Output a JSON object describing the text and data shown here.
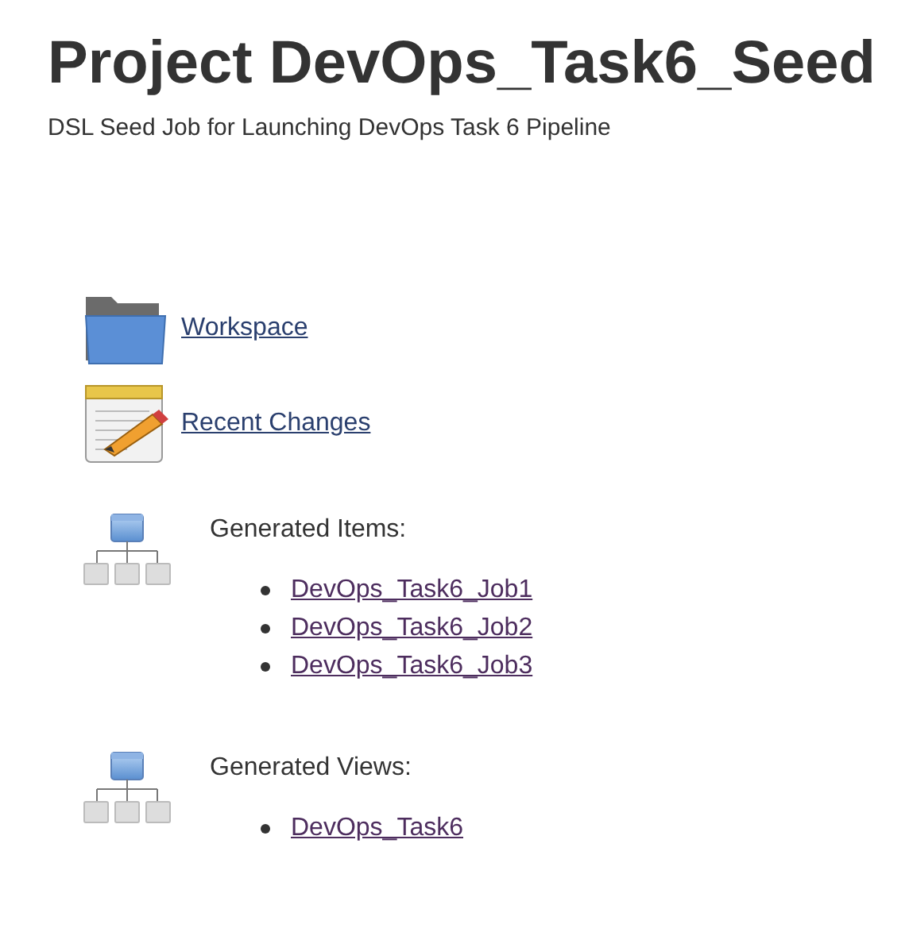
{
  "title": "Project DevOps_Task6_Seed",
  "description": "DSL Seed Job for Launching DevOps Task 6 Pipeline",
  "links": [
    {
      "kind": "folder",
      "label": "Workspace",
      "visited": false
    },
    {
      "kind": "notepad",
      "label": "Recent Changes",
      "visited": false
    }
  ],
  "sections": [
    {
      "heading": "Generated Items:",
      "items": [
        {
          "label": "DevOps_Task6_Job1",
          "visited": true
        },
        {
          "label": "DevOps_Task6_Job2",
          "visited": true
        },
        {
          "label": "DevOps_Task6_Job3",
          "visited": true
        }
      ]
    },
    {
      "heading": "Generated Views:",
      "items": [
        {
          "label": "DevOps_Task6",
          "visited": true
        }
      ]
    }
  ]
}
